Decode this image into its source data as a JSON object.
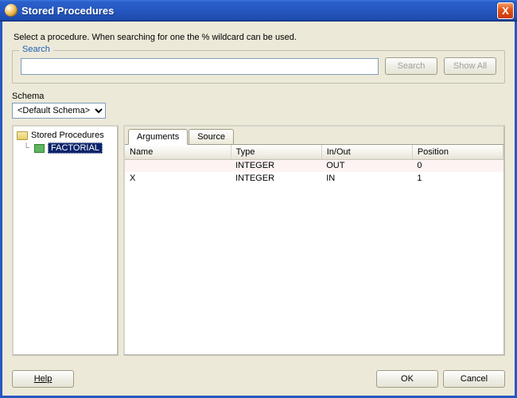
{
  "window": {
    "title": "Stored Procedures",
    "close_glyph": "X"
  },
  "description": "Select a procedure. When searching for one the % wildcard can be used.",
  "search": {
    "legend": "Search",
    "value": "",
    "search_label": "Search",
    "showall_label": "Show All"
  },
  "schema": {
    "label": "Schema",
    "selected": "<Default Schema>"
  },
  "tree": {
    "root_label": "Stored Procedures",
    "items": [
      {
        "label": "FACTORIAL",
        "selected": true
      }
    ]
  },
  "tabs": {
    "items": [
      {
        "label": "Arguments",
        "active": true
      },
      {
        "label": "Source",
        "active": false
      }
    ]
  },
  "args_table": {
    "headers": {
      "name": "Name",
      "type": "Type",
      "inout": "In/Out",
      "position": "Position"
    },
    "rows": [
      {
        "name": "",
        "type": "INTEGER",
        "inout": "OUT",
        "position": "0"
      },
      {
        "name": "X",
        "type": "INTEGER",
        "inout": "IN",
        "position": "1"
      }
    ]
  },
  "buttons": {
    "help": "Help",
    "ok": "OK",
    "cancel": "Cancel"
  }
}
